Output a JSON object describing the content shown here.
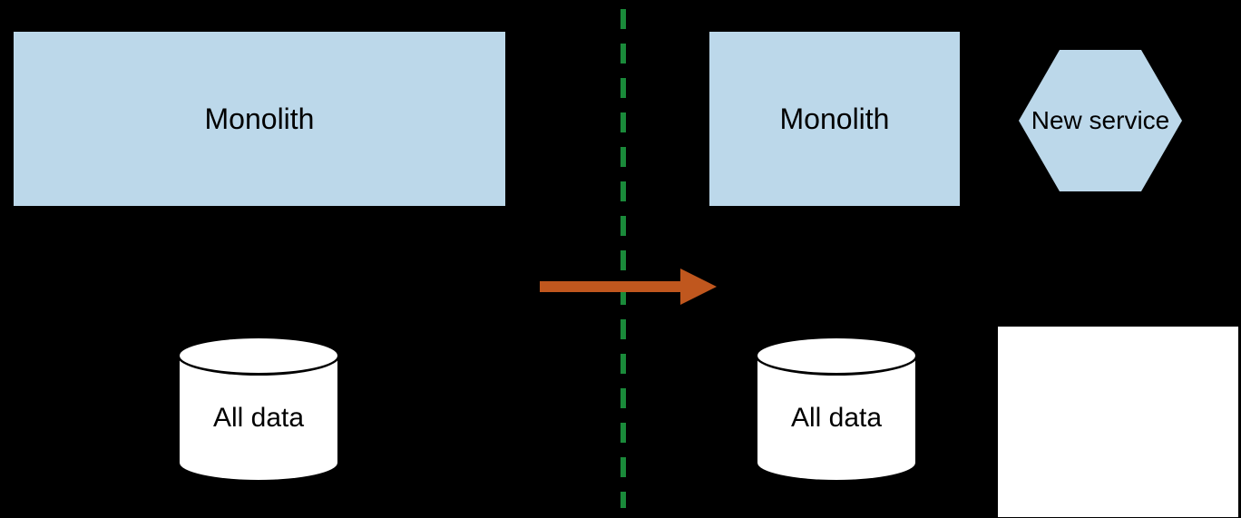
{
  "left": {
    "monolith_label": "Monolith",
    "db_label": "All data"
  },
  "right": {
    "monolith_label": "Monolith",
    "service_label": "New service",
    "db_label": "All data"
  },
  "colors": {
    "box_fill": "#bcd8ea",
    "arrow": "#c0571e",
    "divider": "#1a8a3a"
  }
}
